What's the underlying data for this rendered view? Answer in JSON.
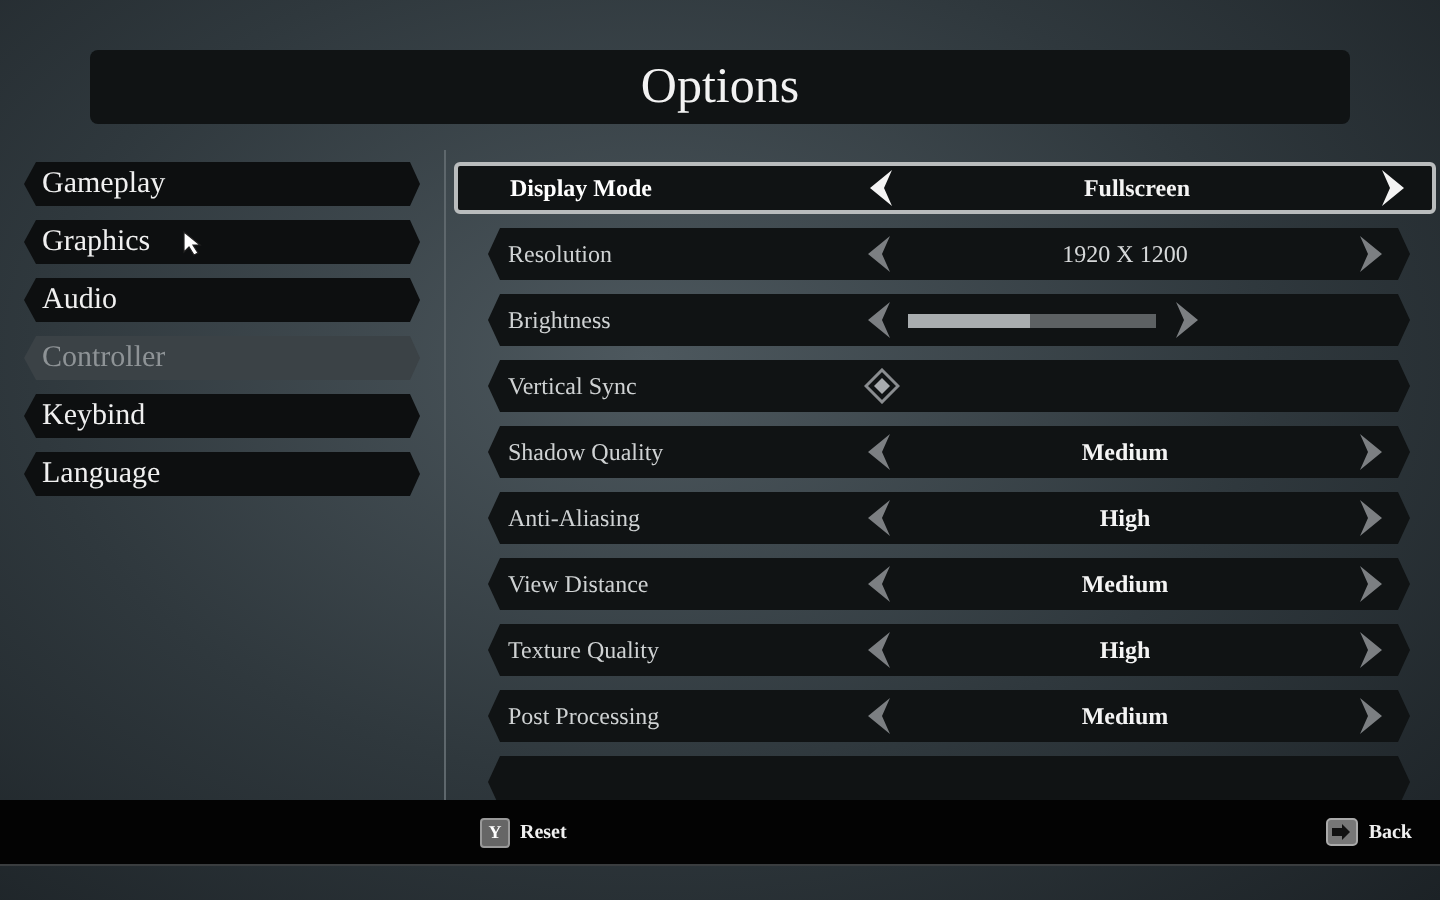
{
  "title": "Options",
  "menu": [
    {
      "label": "Gameplay",
      "disabled": false,
      "hovered": false
    },
    {
      "label": "Graphics",
      "disabled": false,
      "hovered": true
    },
    {
      "label": "Audio",
      "disabled": false,
      "hovered": false
    },
    {
      "label": "Controller",
      "disabled": true,
      "hovered": false
    },
    {
      "label": "Keybind",
      "disabled": false,
      "hovered": false
    },
    {
      "label": "Language",
      "disabled": false,
      "hovered": false
    }
  ],
  "settings": [
    {
      "kind": "choice",
      "label": "Display Mode",
      "value": "Fullscreen",
      "selected": true,
      "dim": false
    },
    {
      "kind": "choice",
      "label": "Resolution",
      "value": "1920 X 1200",
      "selected": false,
      "dim": true
    },
    {
      "kind": "slider",
      "label": "Brightness",
      "level": 0.49,
      "selected": false
    },
    {
      "kind": "toggle",
      "label": "Vertical Sync",
      "on": true,
      "selected": false
    },
    {
      "kind": "choice",
      "label": "Shadow Quality",
      "value": "Medium",
      "selected": false,
      "dim": false
    },
    {
      "kind": "choice",
      "label": "Anti-Aliasing",
      "value": "High",
      "selected": false,
      "dim": false
    },
    {
      "kind": "choice",
      "label": "View Distance",
      "value": "Medium",
      "selected": false,
      "dim": false
    },
    {
      "kind": "choice",
      "label": "Texture Quality",
      "value": "High",
      "selected": false,
      "dim": false
    },
    {
      "kind": "choice",
      "label": "Post Processing",
      "value": "Medium",
      "selected": false,
      "dim": false
    },
    {
      "kind": "partial",
      "selected": false
    }
  ],
  "footer": [
    {
      "kind": "reset",
      "key": "Y",
      "label": "Reset"
    },
    {
      "kind": "back",
      "label": "Back"
    }
  ]
}
